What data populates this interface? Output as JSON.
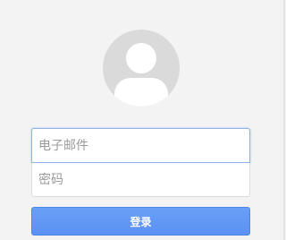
{
  "login": {
    "email_placeholder": "电子邮件",
    "password_placeholder": "密码",
    "submit_label": "登录"
  },
  "colors": {
    "background": "#f3f3f3",
    "accent": "#5b91f3",
    "focus_border": "#8fb3e8",
    "avatar": "#dadada"
  },
  "icons": {
    "avatar": "user-avatar-icon"
  }
}
